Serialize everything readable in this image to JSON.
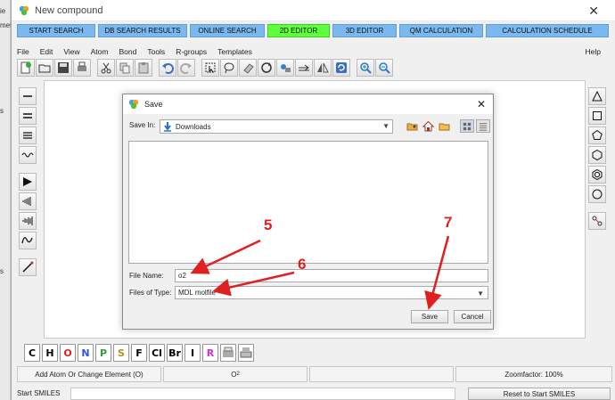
{
  "window": {
    "title": "New compound",
    "close_glyph": "✕"
  },
  "outer_left_fragments": [
    "ie",
    "met",
    "s",
    "s"
  ],
  "tabs": [
    {
      "label": "START SEARCH",
      "active": false
    },
    {
      "label": "DB SEARCH RESULTS",
      "active": false
    },
    {
      "label": "ONLINE SEARCH",
      "active": false
    },
    {
      "label": "2D EDITOR",
      "active": true
    },
    {
      "label": "3D EDITOR",
      "active": false
    },
    {
      "label": "QM CALCULATION",
      "active": false
    },
    {
      "label": "CALCULATION SCHEDULE",
      "active": false
    }
  ],
  "menu": [
    "File",
    "Edit",
    "View",
    "Atom",
    "Bond",
    "Tools",
    "R-groups",
    "Templates"
  ],
  "menu_help": "Help",
  "elements": [
    {
      "symbol": "C",
      "color": "#000000"
    },
    {
      "symbol": "H",
      "color": "#000000"
    },
    {
      "symbol": "O",
      "color": "#e02020"
    },
    {
      "symbol": "N",
      "color": "#3050f0"
    },
    {
      "symbol": "P",
      "color": "#30a030"
    },
    {
      "symbol": "S",
      "color": "#b09020"
    },
    {
      "symbol": "F",
      "color": "#000000"
    },
    {
      "symbol": "Cl",
      "color": "#000000"
    },
    {
      "symbol": "Br",
      "color": "#000000"
    },
    {
      "symbol": "I",
      "color": "#000000"
    },
    {
      "symbol": "R",
      "color": "#d030d0"
    }
  ],
  "status": {
    "hint": "Add Atom Or Change Element (O)",
    "formula_main": "O",
    "formula_sub": "2",
    "zoom": "Zoomfactor: 100%"
  },
  "smiles": {
    "label": "Start SMILES",
    "value": "",
    "reset_label": "Reset to Start SMILES"
  },
  "dialog": {
    "title": "Save",
    "save_in_label": "Save In:",
    "save_in_value": "Downloads",
    "file_name_label": "File Name:",
    "file_name_value": "o2",
    "file_type_label": "Files of Type:",
    "file_type_value": "MDL molfile",
    "save_button": "Save",
    "cancel_button": "Cancel"
  },
  "annotations": {
    "step5": "5",
    "step6": "6",
    "step7": "7",
    "color": "#e02020"
  }
}
